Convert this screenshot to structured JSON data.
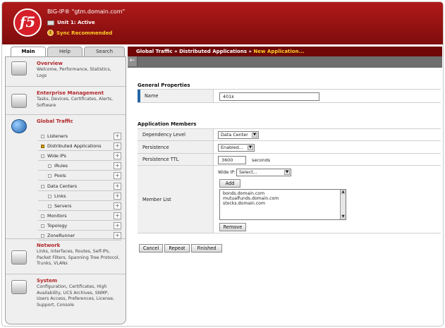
{
  "header": {
    "logo_text": "f5",
    "title": "BIG-IP® \"gtm.domain.com\"",
    "unit_status": "Unit 1: Active",
    "sync_status": "Sync Recommended",
    "sync_icon_glyph": "!"
  },
  "tabs": [
    {
      "label": "Main",
      "active": true
    },
    {
      "label": "Help",
      "active": false
    },
    {
      "label": "Search",
      "active": false
    }
  ],
  "breadcrumb": {
    "part1": "Global Traffic",
    "sep": "»",
    "part2": "Distributed Applications",
    "current": "New Application..."
  },
  "back_glyph": "←",
  "sidebar": {
    "overview": {
      "title": "Overview",
      "desc": "Welcome, Performance, Statistics, Logs"
    },
    "enterprise": {
      "title": "Enterprise Management",
      "desc": "Tasks, Devices, Certificates, Alerts, Software"
    },
    "global_traffic": {
      "title": "Global Traffic",
      "items": [
        {
          "label": "Listeners",
          "indent": 0,
          "selected": false
        },
        {
          "label": "Distributed Applications",
          "indent": 0,
          "selected": true
        },
        {
          "label": "Wide IPs",
          "indent": 0,
          "selected": false
        },
        {
          "label": "iRules",
          "indent": 1,
          "selected": false
        },
        {
          "label": "Pools",
          "indent": 1,
          "selected": false
        },
        {
          "label": "Data Centers",
          "indent": 0,
          "selected": false
        },
        {
          "label": "Links",
          "indent": 1,
          "selected": false
        },
        {
          "label": "Servers",
          "indent": 1,
          "selected": false
        },
        {
          "label": "Monitors",
          "indent": 0,
          "selected": false
        },
        {
          "label": "Topology",
          "indent": 0,
          "selected": false
        },
        {
          "label": "ZoneRunner",
          "indent": 0,
          "selected": false
        }
      ],
      "plus_glyph": "+"
    },
    "network": {
      "title": "Network",
      "desc": "Links, Interfaces, Routes, Self-IPs, Packet Filters, Spanning Tree Protocol, Trunks, VLANs"
    },
    "system": {
      "title": "System",
      "desc": "Configuration, Certificates, High Availability, UCS Archives, SNMP, Users Access, Preferences, License, Support, Console"
    }
  },
  "general": {
    "heading": "General Properties",
    "name_label": "Name",
    "name_value": "401k"
  },
  "members": {
    "heading": "Application Members",
    "dependency_label": "Dependency Level",
    "dependency_value": "Data Center",
    "persistence_label": "Persistence",
    "persistence_value": "Enabled...",
    "ttl_label": "Persistence TTL",
    "ttl_value": "3600",
    "ttl_unit": "seconds",
    "member_list_label": "Member List",
    "wideip_label": "Wide IP:",
    "wideip_value": "Select...",
    "add_label": "Add",
    "list_items": [
      "bonds.domain.com",
      "mutualfunds.domain.com",
      "stocks.domain.com"
    ],
    "remove_label": "Remove"
  },
  "actions": {
    "cancel": "Cancel",
    "repeat": "Repeat",
    "finished": "Finished"
  },
  "colors": {
    "brand_red": "#b01a1a",
    "sync_yellow": "#ffd028",
    "section_title": "#b2262a",
    "required_bar": "#2466a6"
  }
}
